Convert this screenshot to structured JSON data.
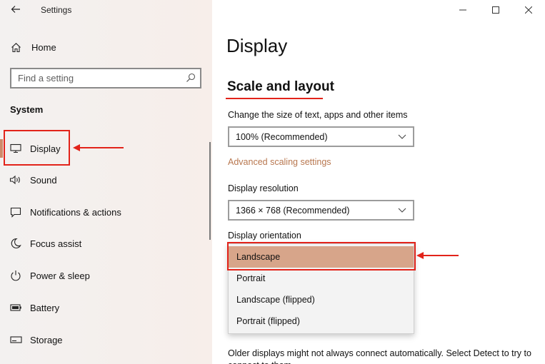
{
  "window": {
    "title": "Settings",
    "controls": [
      "minimize-icon",
      "maximize-icon",
      "close-icon"
    ]
  },
  "sidebar": {
    "back_icon": "back-arrow-icon",
    "home": {
      "label": "Home",
      "icon": "home-icon"
    },
    "search": {
      "placeholder": "Find a setting",
      "icon": "search-icon"
    },
    "section": "System",
    "items": [
      {
        "label": "Display",
        "icon": "monitor-icon",
        "active": true
      },
      {
        "label": "Sound",
        "icon": "speaker-icon",
        "active": false
      },
      {
        "label": "Notifications & actions",
        "icon": "notification-icon",
        "active": false
      },
      {
        "label": "Focus assist",
        "icon": "moon-icon",
        "active": false
      },
      {
        "label": "Power & sleep",
        "icon": "power-icon",
        "active": false
      },
      {
        "label": "Battery",
        "icon": "battery-icon",
        "active": false
      },
      {
        "label": "Storage",
        "icon": "storage-icon",
        "active": false
      }
    ]
  },
  "main": {
    "title": "Display",
    "section": "Scale and layout",
    "scale": {
      "label": "Change the size of text, apps and other items",
      "value": "100% (Recommended)"
    },
    "advanced_link": "Advanced scaling settings",
    "resolution": {
      "label": "Display resolution",
      "value": "1366 × 768 (Recommended)"
    },
    "orientation": {
      "label": "Display orientation",
      "options": [
        "Landscape",
        "Portrait",
        "Landscape (flipped)",
        "Portrait (flipped)"
      ],
      "selected": "Landscape"
    },
    "bottom_text": "Older displays might not always connect automatically. Select Detect to try to connect to them."
  },
  "colors": {
    "accent": "#cf8a69",
    "selected_option": "#d7a58a",
    "link": "#b8774f",
    "annotation": "#e2231a"
  }
}
